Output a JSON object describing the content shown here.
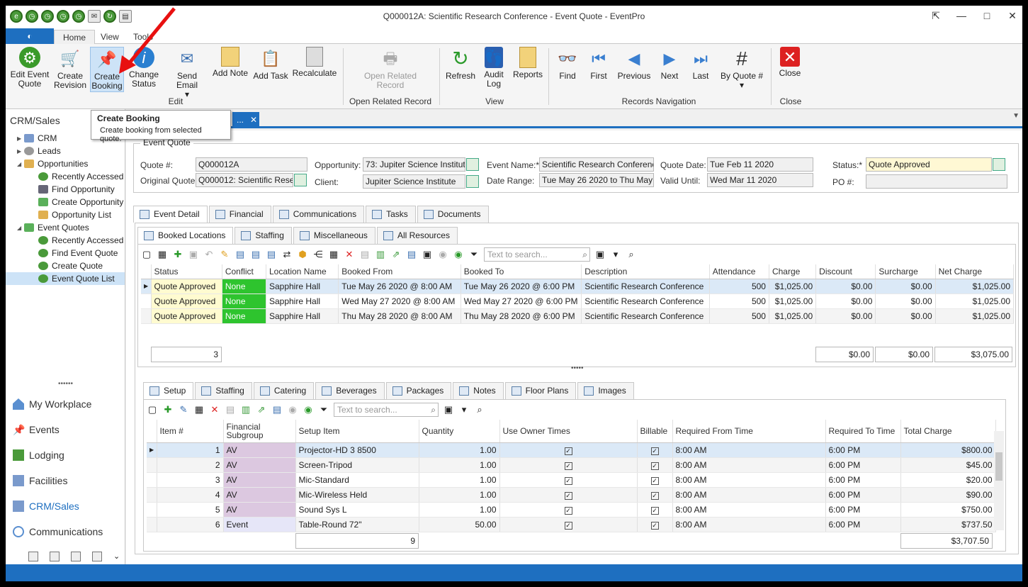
{
  "window": {
    "title": "Q000012A: Scientific Research Conference - Event Quote - EventPro"
  },
  "ribbon_tabs": [
    "Home",
    "View",
    "Tools"
  ],
  "ribbon": {
    "buttons": [
      {
        "l1": "Edit Event",
        "l2": "Quote"
      },
      {
        "l1": "Create",
        "l2": "Revision"
      },
      {
        "l1": "Create",
        "l2": "Booking"
      },
      {
        "l1": "Change",
        "l2": "Status"
      },
      {
        "l1": "Send Email",
        "l2": ""
      },
      {
        "l1": "Add Note",
        "l2": ""
      },
      {
        "l1": "Add Task",
        "l2": ""
      },
      {
        "l1": "Recalculate",
        "l2": ""
      },
      {
        "l1": "Open Related",
        "l2": "Record"
      },
      {
        "l1": "Refresh",
        "l2": ""
      },
      {
        "l1": "Audit",
        "l2": "Log"
      },
      {
        "l1": "Reports",
        "l2": ""
      },
      {
        "l1": "Find",
        "l2": ""
      },
      {
        "l1": "First",
        "l2": ""
      },
      {
        "l1": "Previous",
        "l2": ""
      },
      {
        "l1": "Next",
        "l2": ""
      },
      {
        "l1": "Last",
        "l2": ""
      },
      {
        "l1": "By Quote #",
        "l2": ""
      },
      {
        "l1": "Close",
        "l2": ""
      }
    ],
    "groups": [
      "Edit",
      "Open Related Record",
      "View",
      "Records Navigation",
      "Close"
    ]
  },
  "tooltip": {
    "title": "Create Booking",
    "desc": "Create booking from selected quote."
  },
  "sidebar": {
    "title": "CRM/Sales",
    "tree": [
      "CRM",
      "Leads",
      "Opportunities",
      "Recently Accessed",
      "Find Opportunity",
      "Create Opportunity",
      "Opportunity List",
      "Event Quotes",
      "Recently Accessed",
      "Find Event Quote",
      "Create Quote",
      "Event Quote List"
    ],
    "nav": [
      "My Workplace",
      "Events",
      "Lodging",
      "Facilities",
      "CRM/Sales",
      "Communications"
    ]
  },
  "doc_tab": "...",
  "quote": {
    "group_title": "Event Quote",
    "labels": {
      "quote_no": "Quote #:",
      "orig": "Original Quote:",
      "opp": "Opportunity:",
      "client": "Client:",
      "event_name": "Event Name:*",
      "date_range": "Date Range:",
      "quote_date": "Quote Date:",
      "valid": "Valid Until:",
      "status": "Status:*",
      "po": "PO #:"
    },
    "quote_no": "Q000012A",
    "orig": "Q000012: Scientific Rese...",
    "opp": "73: Jupiter Science Institute",
    "client": "Jupiter Science Institute",
    "event_name": "Scientific Research Conference",
    "date_range": "Tue May 26 2020 to Thu May 28",
    "quote_date": "Tue Feb 11 2020",
    "valid": "Wed Mar 11 2020",
    "status": "Quote Approved",
    "po": ""
  },
  "tabs1": [
    "Event Detail",
    "Financial",
    "Communications",
    "Tasks",
    "Documents"
  ],
  "tabs2": [
    "Booked Locations",
    "Staffing",
    "Miscellaneous",
    "All Resources"
  ],
  "search_placeholder": "Text to search...",
  "locations": {
    "headers": [
      "Status",
      "Conflict",
      "Location Name",
      "Booked From",
      "Booked To",
      "Description",
      "Attendance",
      "Charge",
      "Discount",
      "Surcharge",
      "Net Charge"
    ],
    "rows": [
      [
        "Quote Approved",
        "None",
        "Sapphire Hall",
        "Tue May 26 2020 @ 8:00 AM",
        "Tue May 26 2020 @ 6:00 PM",
        "Scientific Research Conference",
        "500",
        "$1,025.00",
        "$0.00",
        "$0.00",
        "$1,025.00"
      ],
      [
        "Quote Approved",
        "None",
        "Sapphire Hall",
        "Wed May 27 2020 @ 8:00 AM",
        "Wed May 27 2020 @ 6:00 PM",
        "Scientific Research Conference",
        "500",
        "$1,025.00",
        "$0.00",
        "$0.00",
        "$1,025.00"
      ],
      [
        "Quote Approved",
        "None",
        "Sapphire Hall",
        "Thu May 28 2020 @ 8:00 AM",
        "Thu May 28 2020 @ 6:00 PM",
        "Scientific Research Conference",
        "500",
        "$1,025.00",
        "$0.00",
        "$0.00",
        "$1,025.00"
      ]
    ],
    "totals": {
      "count": "3",
      "discount": "$0.00",
      "surcharge": "$0.00",
      "net": "$3,075.00"
    }
  },
  "tabs3": [
    "Setup",
    "Staffing",
    "Catering",
    "Beverages",
    "Packages",
    "Notes",
    "Floor Plans",
    "Images"
  ],
  "setup": {
    "headers": [
      "Item #",
      "Financial Subgroup",
      "Setup Item",
      "Quantity",
      "Use Owner Times",
      "Billable",
      "Required From Time",
      "Required To Time",
      "Total Charge"
    ],
    "rows": [
      [
        "1",
        "AV",
        "Projector-HD 3 8500",
        "1.00",
        "✓",
        "✓",
        "8:00 AM",
        "6:00 PM",
        "$800.00"
      ],
      [
        "2",
        "AV",
        "Screen-Tripod",
        "1.00",
        "✓",
        "✓",
        "8:00 AM",
        "6:00 PM",
        "$45.00"
      ],
      [
        "3",
        "AV",
        "Mic-Standard",
        "1.00",
        "✓",
        "✓",
        "8:00 AM",
        "6:00 PM",
        "$20.00"
      ],
      [
        "4",
        "AV",
        "Mic-Wireless Held",
        "1.00",
        "✓",
        "✓",
        "8:00 AM",
        "6:00 PM",
        "$90.00"
      ],
      [
        "5",
        "AV",
        "Sound Sys L",
        "1.00",
        "✓",
        "✓",
        "8:00 AM",
        "6:00 PM",
        "$750.00"
      ],
      [
        "6",
        "Event",
        "Table-Round 72\"",
        "50.00",
        "✓",
        "✓",
        "8:00 AM",
        "6:00 PM",
        "$737.50"
      ]
    ],
    "totals": {
      "count": "9",
      "total": "$3,707.50"
    }
  }
}
